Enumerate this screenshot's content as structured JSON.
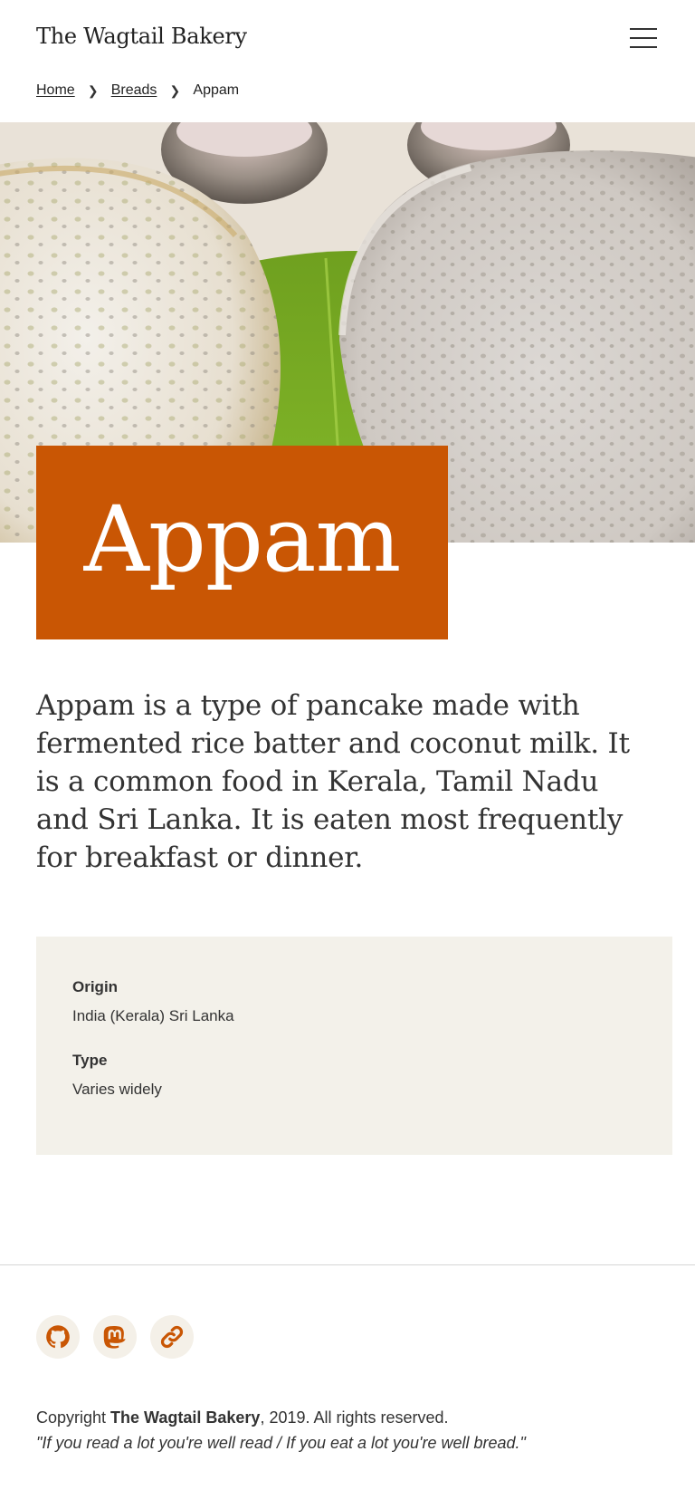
{
  "header": {
    "site_title": "The Wagtail Bakery",
    "menu_icon": "hamburger-menu-icon"
  },
  "breadcrumb": {
    "items": [
      "Home",
      "Breads"
    ],
    "current": "Appam",
    "separator_icon": "chevron-right-icon"
  },
  "hero": {
    "image_subject": "Two appam pancakes on a banana leaf with small bowls behind"
  },
  "page": {
    "title": "Appam",
    "intro": "Appam is a type of pancake made with fermented rice batter and coconut milk. It is a common food in Kerala, Tamil Nadu and Sri Lanka. It is eaten most frequently for breakfast or dinner."
  },
  "facts": {
    "origin_label": "Origin",
    "origin_value": "India (Kerala) Sri Lanka",
    "type_label": "Type",
    "type_value": "Varies widely"
  },
  "footer": {
    "social": [
      {
        "icon": "github-icon"
      },
      {
        "icon": "mastodon-icon"
      },
      {
        "icon": "link-icon"
      }
    ],
    "copyright_prefix": "Copyright ",
    "copyright_name": "The Wagtail Bakery",
    "copyright_suffix": ", 2019. All rights reserved.",
    "quote": "\"If you read a lot you're well read / If you eat a lot you're well bread.\""
  },
  "colors": {
    "accent": "#c95604",
    "fact_panel_bg": "#f3f1ea",
    "social_btn_bg": "#f4f0e8",
    "text": "#333333"
  }
}
